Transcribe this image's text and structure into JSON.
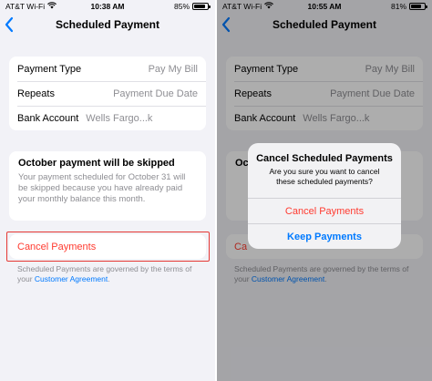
{
  "left_screen": {
    "status": {
      "carrier": "AT&T Wi-Fi",
      "time": "10:38 AM",
      "battery": "85%",
      "battery_level": 0.85
    },
    "nav": {
      "title": "Scheduled Payment",
      "back_icon": "chevron-left-icon"
    },
    "details": [
      {
        "label": "Payment Type",
        "value": "Pay My Bill"
      },
      {
        "label": "Repeats",
        "value": "Payment Due Date"
      },
      {
        "label": "Bank Account",
        "value": "Wells Fargo...k"
      }
    ],
    "notice": {
      "title": "October payment will be skipped",
      "body": "Your payment scheduled for October 31 will be skipped because you have already paid your monthly balance this month."
    },
    "cancel_label": "Cancel Payments",
    "footer": {
      "text": "Scheduled Payments are governed by the terms of your",
      "link": "Customer Agreement",
      "end": "."
    },
    "colors": {
      "destructive": "#ff3b30",
      "link": "#007aff",
      "highlight": "#e53935"
    }
  },
  "right_screen": {
    "status": {
      "carrier": "AT&T Wi-Fi",
      "time": "10:55 AM",
      "battery": "81%",
      "battery_level": 0.81
    },
    "nav": {
      "title": "Scheduled Payment",
      "back_icon": "chevron-left-icon"
    },
    "details": [
      {
        "label": "Payment Type",
        "value": "Pay My Bill"
      },
      {
        "label": "Repeats",
        "value": "Payment Due Date"
      },
      {
        "label": "Bank Account",
        "value": "Wells Fargo...k"
      }
    ],
    "notice_title_partial": "Oc",
    "cancel_partial": "Ca",
    "footer": {
      "text": "Scheduled Payments are governed by the terms of your",
      "link": "Customer Agreement",
      "end": "."
    },
    "alert": {
      "title": "Cancel Scheduled Payments",
      "message": "Are you sure you want to cancel these scheduled payments?",
      "destructive_button": "Cancel Payments",
      "keep_button": "Keep Payments"
    }
  }
}
